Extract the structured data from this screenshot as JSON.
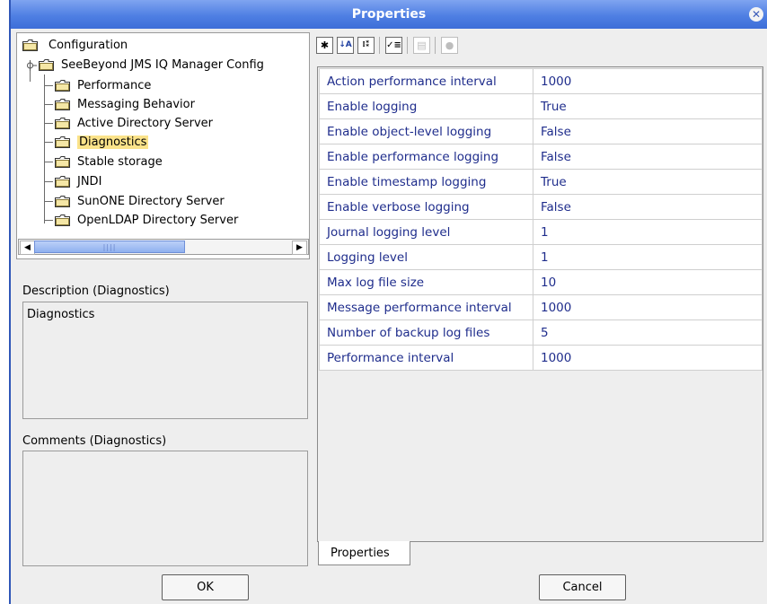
{
  "window": {
    "title": "Properties"
  },
  "tree": {
    "root": "Configuration",
    "node": "SeeBeyond JMS IQ Manager Config",
    "children": [
      "Performance",
      "Messaging Behavior",
      "Active Directory Server",
      "Diagnostics",
      "Stable storage",
      "JNDI",
      "SunONE Directory Server",
      "OpenLDAP Directory Server"
    ],
    "selected": "Diagnostics"
  },
  "description": {
    "label": "Description (Diagnostics)",
    "text": "Diagnostics"
  },
  "comments": {
    "label": "Comments (Diagnostics)",
    "text": ""
  },
  "toolbar": {
    "icons": [
      "categorized-view-icon",
      "sort-alphabetical-icon",
      "expand-properties-icon",
      "checklist-icon",
      "description-toggle-icon",
      "help-icon"
    ]
  },
  "properties": [
    {
      "name": "Action performance interval",
      "value": "1000"
    },
    {
      "name": "Enable logging",
      "value": "True"
    },
    {
      "name": "Enable object-level logging",
      "value": "False"
    },
    {
      "name": "Enable performance logging",
      "value": "False"
    },
    {
      "name": "Enable timestamp logging",
      "value": "True"
    },
    {
      "name": "Enable verbose logging",
      "value": "False"
    },
    {
      "name": "Journal logging level",
      "value": "1"
    },
    {
      "name": "Logging level",
      "value": "1"
    },
    {
      "name": "Max log file size",
      "value": "10"
    },
    {
      "name": "Message performance interval",
      "value": "1000"
    },
    {
      "name": "Number of backup log files",
      "value": "5"
    },
    {
      "name": "Performance interval",
      "value": "1000"
    }
  ],
  "tab": {
    "label": "Properties"
  },
  "buttons": {
    "ok": "OK",
    "cancel": "Cancel"
  }
}
